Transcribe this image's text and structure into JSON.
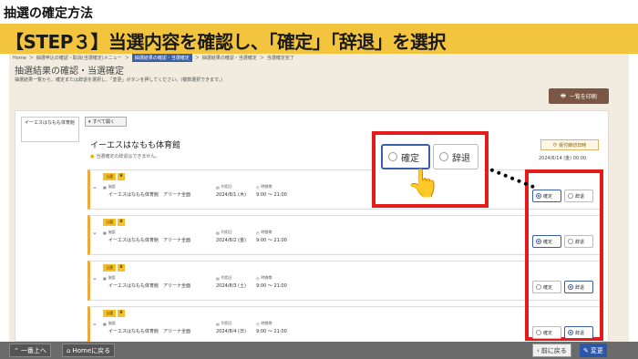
{
  "heading": "抽選の確定方法",
  "banner": "【STEP３】当選内容を確認し、「確定」「辞退」を選択",
  "breadcrumb": [
    "Home",
    "＞",
    "抽選申込の確認・取消(当選確定)メニュー",
    "＞",
    "抽選結果の確認・当選確定",
    "＞",
    "抽選結果の確認・当選確定",
    "＞",
    "当選確定完了"
  ],
  "page_title": "抽選結果の確認・当選確定",
  "page_desc": "抽選結果一覧から、確定または辞退を選択し、「変更」ボタンを押してください。(複数選択できます。)",
  "print_button": "一覧を印刷",
  "left_card": "イーエスはなもも体育館",
  "expand_all": "すべて開く",
  "facility": {
    "name": "イーエスはなもも体育館",
    "note": "当選確定の辞退はできません。",
    "deadline_badge": "受付締切日時",
    "deadline_date": "2024/6/14 (金) 00:00"
  },
  "rows": [
    {
      "badge": "当選",
      "type": "施設",
      "name": "イーエスはなもも体育館　アリーナ全面",
      "date_label": "利用日",
      "date": "2024/8/1 (木)",
      "time_label": "時間帯",
      "time": "9:00 ～ 21:00",
      "confirm": "確定",
      "decline": "辞退",
      "selected": "confirm"
    },
    {
      "badge": "当選",
      "type": "施設",
      "name": "イーエスはなもも体育館　アリーナ全面",
      "date_label": "利用日",
      "date": "2024/8/2 (金)",
      "time_label": "時間帯",
      "time": "9:00 ～ 21:00",
      "confirm": "確定",
      "decline": "辞退",
      "selected": "confirm"
    },
    {
      "badge": "当選",
      "type": "施設",
      "name": "イーエスはなもも体育館　アリーナ全面",
      "date_label": "利用日",
      "date": "2024/8/3 (土)",
      "time_label": "時間帯",
      "time": "9:00 ～ 21:00",
      "confirm": "確定",
      "decline": "辞退",
      "selected": "decline"
    },
    {
      "badge": "当選",
      "type": "施設",
      "name": "イーエスはなもも体育館　アリーナ全面",
      "date_label": "利用日",
      "date": "2024/8/4 (日)",
      "time_label": "時間帯",
      "time": "9:00 ～ 21:00",
      "confirm": "確定",
      "decline": "辞退",
      "selected": "decline"
    }
  ],
  "zoom": {
    "confirm": "確定",
    "decline": "辞退",
    "selected": "confirm"
  },
  "footer": {
    "top": "一番上へ",
    "home": "Homeに戻る",
    "back": "前に戻る",
    "change": "変更"
  },
  "colors": {
    "banner": "#f3c53f",
    "highlight": "#e31b1b",
    "primary": "#2c57a8",
    "print": "#7b5644"
  }
}
